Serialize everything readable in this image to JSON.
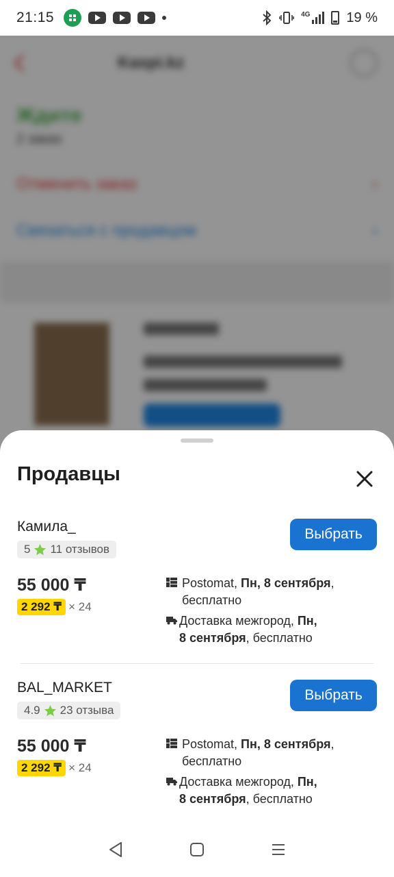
{
  "status_bar": {
    "time": "21:15",
    "battery_text": "19 %",
    "network": "4G"
  },
  "background_page": {
    "title": "Kaspi.kz",
    "status": "Ждите",
    "sub": "2 заказ",
    "link_red": "Отменить заказ",
    "link_blue": "Связаться с продавцом"
  },
  "sheet": {
    "title": "Продавцы",
    "sellers": [
      {
        "name": "Камила_",
        "rating": "5",
        "reviews": "11 отзывов",
        "button": "Выбрать",
        "price": "55 000 ₸",
        "installment": "2 292 ₸",
        "installment_times": "× 24",
        "delivery1": {
          "pre": "Postomat, ",
          "bold": "Пн, 8 сентября",
          "post": ",",
          "line2": "бесплатно"
        },
        "delivery2": {
          "pre": "Доставка межгород, ",
          "bold1": "Пн,",
          "bold2": "8 сентября",
          "post": ", бесплатно"
        }
      },
      {
        "name": "BAL_MARKET",
        "rating": "4.9",
        "reviews": "23 отзыва",
        "button": "Выбрать",
        "price": "55 000 ₸",
        "installment": "2 292 ₸",
        "installment_times": "× 24",
        "delivery1": {
          "pre": "Postomat, ",
          "bold": "Пн, 8 сентября",
          "post": ",",
          "line2": "бесплатно"
        },
        "delivery2": {
          "pre": "Доставка межгород, ",
          "bold1": "Пн,",
          "bold2": "8 сентября",
          "post": ", бесплатно"
        }
      }
    ]
  },
  "colors": {
    "primary_button": "#1a73d1",
    "installment_badge": "#ffd600",
    "star": "#7ccc4a"
  },
  "icons": [
    "bluetooth-icon",
    "vibrate-icon",
    "signal-icon",
    "battery-icon",
    "close-icon",
    "star-icon",
    "postomat-icon",
    "truck-icon",
    "back-nav-icon",
    "home-nav-icon",
    "menu-nav-icon"
  ]
}
